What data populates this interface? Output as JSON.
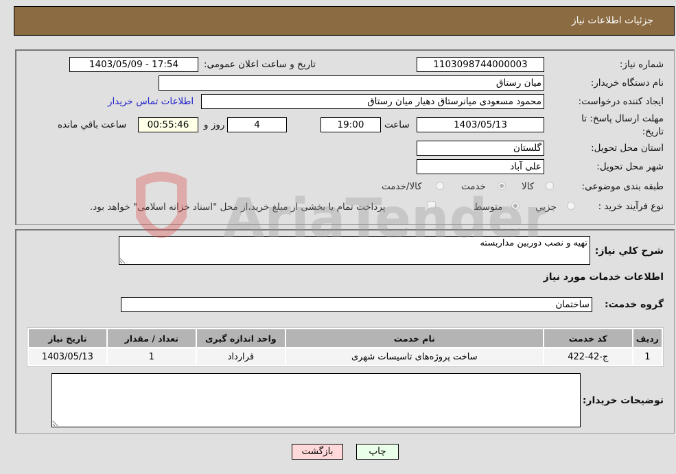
{
  "header": {
    "title": "جزئیات اطلاعات نیاز"
  },
  "details": {
    "need_number": {
      "label": "شماره نیاز:",
      "value": "1103098744000003"
    },
    "announce_datetime": {
      "label": "تاریخ و ساعت اعلان عمومی:",
      "value": "1403/05/09 - 17:54"
    },
    "buyer_org": {
      "label": "نام دستگاه خریدار:",
      "value": "میان رستاق"
    },
    "requester": {
      "label": "ایجاد کننده درخواست:",
      "value": "محمود مسعودی میانرستاق دهیار میان رستاق"
    },
    "contact_link": "اطلاعات تماس خریدار",
    "deadline": {
      "label": "مهلت ارسال پاسخ: تا تاریخ:",
      "date": "1403/05/13",
      "time_label": "ساعت",
      "time": "19:00",
      "days": "4",
      "days_label": "روز و",
      "remaining": "00:55:46",
      "remaining_label": "ساعت باقي مانده"
    },
    "province": {
      "label": "استان محل تحویل:",
      "value": "گلستان"
    },
    "city": {
      "label": "شهر محل تحویل:",
      "value": "علی آباد"
    },
    "category": {
      "label": "طبقه بندی موضوعی:",
      "options": [
        {
          "label": "کالا",
          "checked": false
        },
        {
          "label": "خدمت",
          "checked": true
        },
        {
          "label": "کالا/خدمت",
          "checked": false
        }
      ]
    },
    "purchase_type": {
      "label": "نوع فرآیند خرید :",
      "options": [
        {
          "label": "جزيي",
          "checked": false
        },
        {
          "label": "متوسط",
          "checked": true
        }
      ],
      "treasury_note": "پرداخت تمام یا بخشی از مبلغ خرید،از محل \"اسناد خزانه اسلامی\" خواهد بود.",
      "treasury_checked": false
    }
  },
  "services": {
    "description_label": "شرح کلي نیاز:",
    "description_value": "تهیه و نصب دوربین مداربسته",
    "section_title": "اطلاعات خدمات مورد نیاز",
    "group_label": "گروه خدمت:",
    "group_value": "ساختمان",
    "table": {
      "headers": [
        "ردیف",
        "کد خدمت",
        "نام خدمت",
        "واحد اندازه گیری",
        "تعداد / مقدار",
        "تاریخ نیاز"
      ],
      "rows": [
        [
          "1",
          "ج-42-422",
          "ساخت پروژه‌های تاسیسات شهری",
          "قرارداد",
          "1",
          "1403/05/13"
        ]
      ]
    },
    "buyer_notes_label": "توضیحات خریدار:",
    "buyer_notes_value": ""
  },
  "buttons": {
    "print": "چاپ",
    "back": "بازگشت"
  },
  "watermark": {
    "text": "AriaTender.neT"
  }
}
